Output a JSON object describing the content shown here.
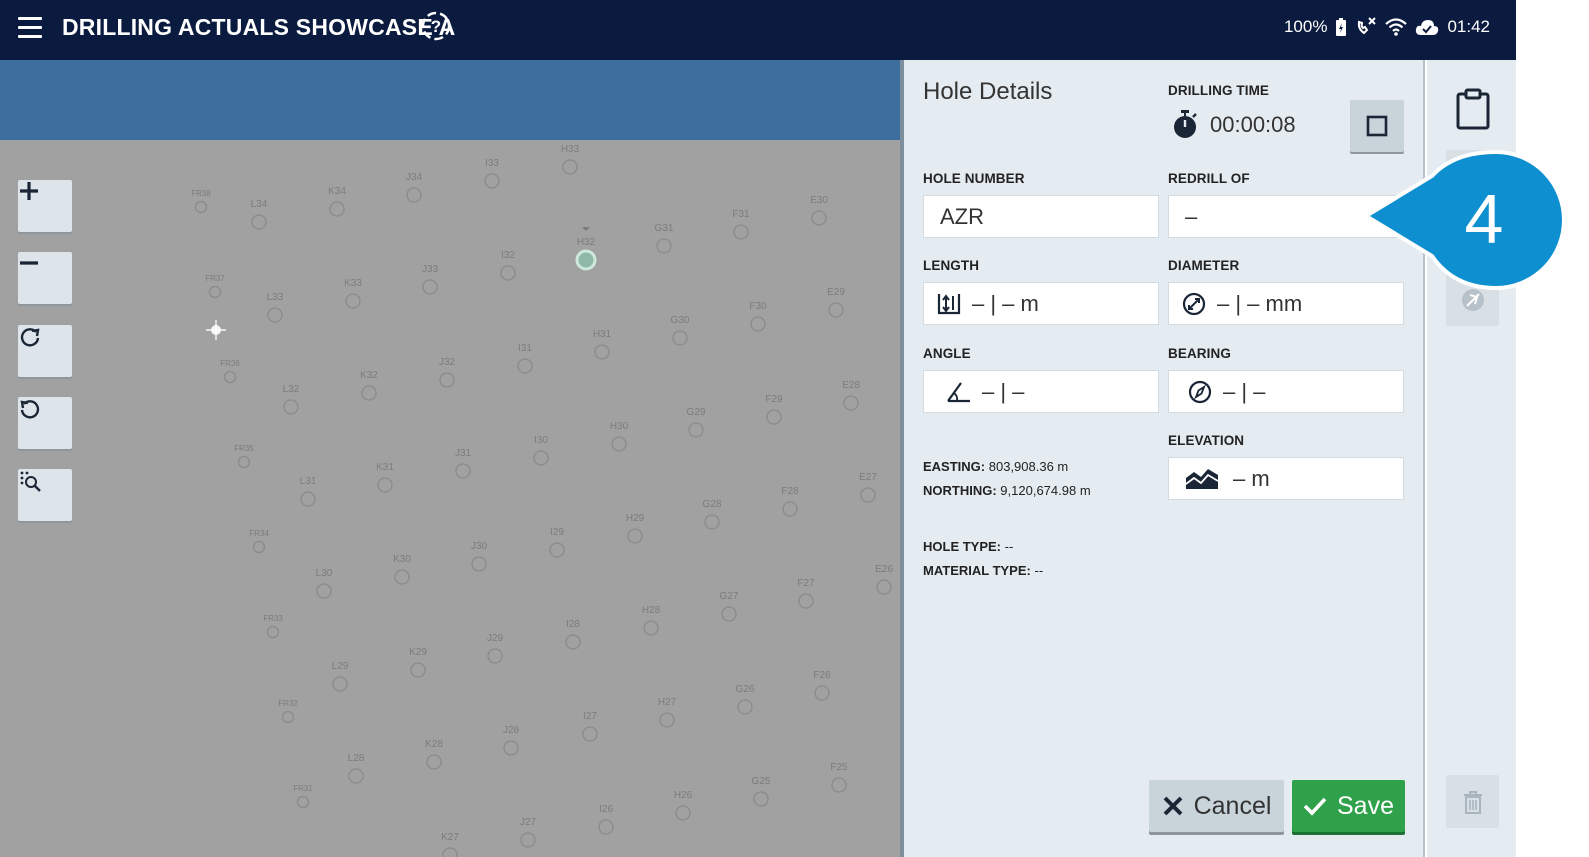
{
  "header": {
    "title": "DRILLING ACTUALS SHOWCASE A",
    "battery": "100%",
    "time": "01:42"
  },
  "map": {
    "holes": [
      "FR38",
      "L34",
      "K34",
      "J34",
      "I33",
      "H33",
      "F31",
      "E30",
      "G31",
      "H32",
      "FR37",
      "L33",
      "K33",
      "J33",
      "I32",
      "FR36",
      "L32",
      "K32",
      "J32",
      "I31",
      "H31",
      "G30",
      "F30",
      "E29",
      "FR35",
      "L31",
      "K31",
      "J31",
      "I30",
      "H30",
      "G29",
      "F29",
      "E28",
      "FR34",
      "L30",
      "K30",
      "J30",
      "I29",
      "H29",
      "G28",
      "F28",
      "E27",
      "FR33",
      "L29",
      "K29",
      "J29",
      "I28",
      "H28",
      "G27",
      "F27",
      "E26",
      "FR32",
      "L28",
      "K28",
      "J28",
      "I27",
      "H27",
      "G26",
      "F26",
      "FR31",
      "K27",
      "J27",
      "I26",
      "H26",
      "G25",
      "F25"
    ],
    "selected_hole": "H32"
  },
  "panel": {
    "title": "Hole Details",
    "drilling_time_label": "DRILLING TIME",
    "drilling_time": "00:00:08",
    "hole_number_label": "HOLE NUMBER",
    "hole_number": "AZR",
    "redrill_label": "REDRILL OF",
    "redrill_value": "–",
    "length_label": "LENGTH",
    "length_value": "– | – m",
    "diameter_label": "DIAMETER",
    "diameter_value": "– | – mm",
    "angle_label": "ANGLE",
    "angle_value": "– | –",
    "bearing_label": "BEARING",
    "bearing_value": "– | –",
    "elevation_label": "ELEVATION",
    "elevation_value": "– m",
    "easting_label": "EASTING:",
    "easting_value": "803,908.36 m",
    "northing_label": "NORTHING:",
    "northing_value": "9,120,674.98 m",
    "hole_type_label": "HOLE TYPE:",
    "hole_type_value": "--",
    "material_type_label": "MATERIAL TYPE:",
    "material_type_value": "--",
    "cancel_label": "Cancel",
    "save_label": "Save"
  },
  "callout": {
    "number": "4",
    "color": "#0e8fd0"
  },
  "colors": {
    "topbar": "#0b1a3f",
    "map_header": "#3d6f9e",
    "map_bg": "#a1a1a1",
    "panel_bg": "#e5ecf1",
    "save": "#2ea14a"
  }
}
